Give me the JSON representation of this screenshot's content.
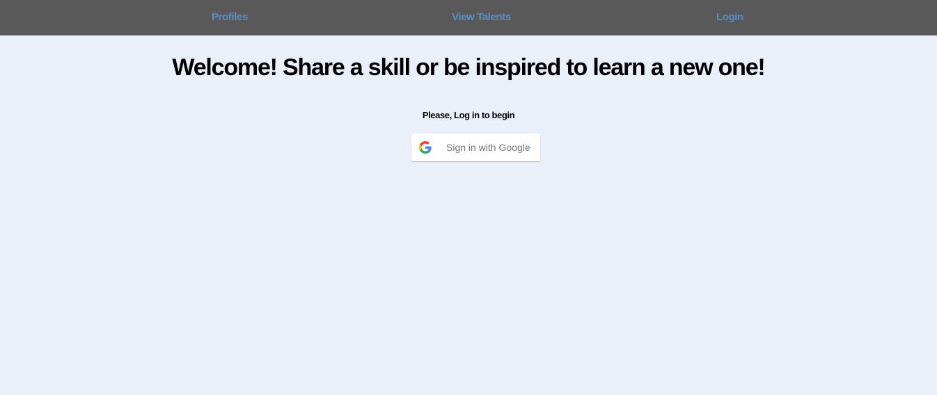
{
  "nav": {
    "items": [
      {
        "label": "Profiles"
      },
      {
        "label": "View Talents"
      },
      {
        "label": "Login"
      }
    ]
  },
  "main": {
    "headline": "Welcome! Share a skill or be inspired to learn a new one!",
    "prompt": "Please, Log in to begin",
    "google_button_label": "Sign in with Google",
    "google_button_icon": "google-logo-icon"
  },
  "colors": {
    "navbar_bg": "#595959",
    "nav_link": "#5b8dc4",
    "page_bg": "#e9f0fa",
    "headline": "#000000",
    "button_bg": "#ffffff",
    "button_text": "#757575"
  }
}
